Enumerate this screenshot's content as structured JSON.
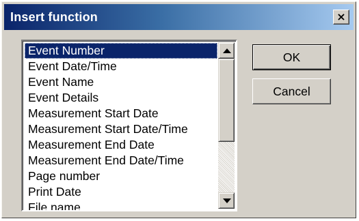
{
  "dialog": {
    "title": "Insert function",
    "close_label": "×",
    "ok_label": "OK",
    "cancel_label": "Cancel"
  },
  "list": {
    "selected_index": 0,
    "items": [
      "Event Number",
      "Event Date/Time",
      "Event Name",
      "Event Details",
      "Measurement Start Date",
      "Measurement Start Date/Time",
      "Measurement End Date",
      "Measurement End Date/Time",
      "Page number",
      "Print Date",
      "File name"
    ]
  },
  "colors": {
    "selection": "#0a246a",
    "titlebar_start": "#0a246a",
    "titlebar_end": "#a6caf0",
    "face": "#d4d0c8"
  },
  "icons": {
    "close": "close-icon",
    "scroll_up": "arrow-up-icon",
    "scroll_down": "arrow-down-icon"
  }
}
